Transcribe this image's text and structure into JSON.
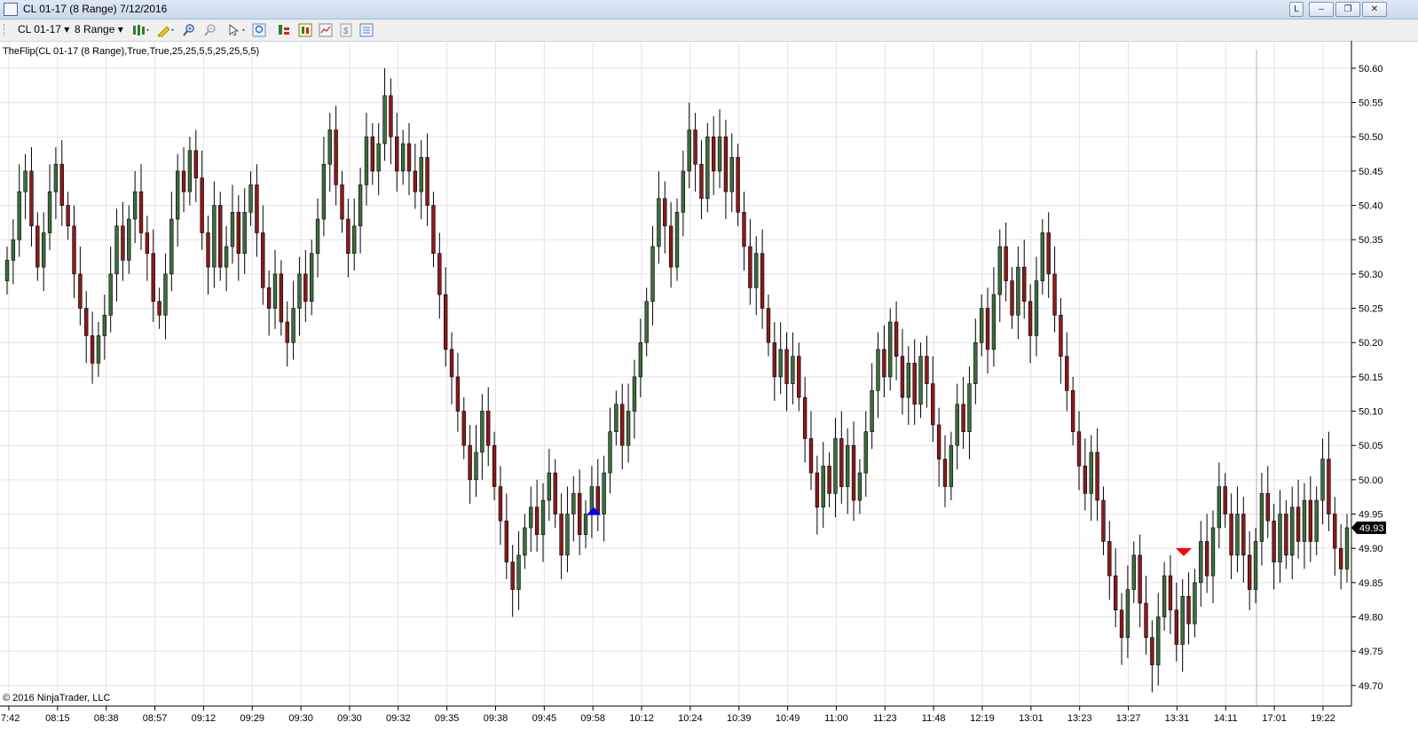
{
  "window": {
    "title": "CL 01-17 (8 Range)  7/12/2016",
    "buttons": [
      "L"
    ]
  },
  "toolbar": {
    "instrument": "CL 01-17",
    "period": "8 Range"
  },
  "indicator_label": "TheFlip(CL 01-17 (8 Range),True,True,25,25,5,5,25,25,5,5)",
  "copyright": "© 2016 NinjaTrader, LLC",
  "colors": {
    "up": "#3c6e3c",
    "down": "#8b1a1a",
    "buy_marker": "#0000ff",
    "sell_marker": "#ff0000"
  },
  "chart_data": {
    "type": "candlestick",
    "ylim": [
      49.67,
      50.64
    ],
    "yticks": [
      "50.60",
      "50.55",
      "50.50",
      "50.45",
      "50.40",
      "50.35",
      "50.30",
      "50.25",
      "50.20",
      "50.15",
      "50.10",
      "50.05",
      "50.00",
      "49.95",
      "49.90",
      "49.85",
      "49.80",
      "49.75",
      "49.70"
    ],
    "xticks": [
      "7:42",
      "08:15",
      "08:38",
      "08:57",
      "09:12",
      "09:29",
      "09:30",
      "09:30",
      "09:32",
      "09:35",
      "09:38",
      "09:45",
      "09:58",
      "10:12",
      "10:24",
      "10:39",
      "10:49",
      "11:00",
      "11:23",
      "11:48",
      "12:19",
      "13:01",
      "13:23",
      "13:27",
      "13:31",
      "14:11",
      "17:01",
      "19:22"
    ],
    "last_price": "49.93",
    "closes": [
      50.32,
      50.35,
      50.42,
      50.45,
      50.37,
      50.31,
      50.36,
      50.42,
      50.46,
      50.4,
      50.37,
      50.3,
      50.25,
      50.21,
      50.17,
      50.21,
      50.24,
      50.3,
      50.37,
      50.32,
      50.38,
      50.42,
      50.36,
      50.33,
      50.26,
      50.24,
      50.3,
      50.38,
      50.45,
      50.42,
      50.48,
      50.44,
      50.36,
      50.31,
      50.4,
      50.31,
      50.34,
      50.39,
      50.33,
      50.39,
      50.43,
      50.36,
      50.28,
      50.25,
      50.3,
      50.23,
      50.2,
      50.25,
      50.3,
      50.26,
      50.33,
      50.38,
      50.46,
      50.51,
      50.43,
      50.38,
      50.33,
      50.37,
      50.43,
      50.5,
      50.45,
      50.49,
      50.56,
      50.5,
      50.45,
      50.49,
      50.45,
      50.42,
      50.47,
      50.4,
      50.33,
      50.27,
      50.19,
      50.15,
      50.1,
      50.05,
      50.0,
      50.04,
      50.1,
      50.05,
      49.99,
      49.94,
      49.88,
      49.84,
      49.89,
      49.93,
      49.96,
      49.92,
      49.97,
      50.01,
      49.95,
      49.89,
      49.95,
      49.98,
      49.92,
      49.95,
      49.99,
      49.95,
      50.01,
      50.07,
      50.11,
      50.05,
      50.1,
      50.15,
      50.2,
      50.26,
      50.34,
      50.41,
      50.37,
      50.31,
      50.39,
      50.45,
      50.51,
      50.46,
      50.41,
      50.5,
      50.45,
      50.5,
      50.42,
      50.47,
      50.39,
      50.34,
      50.28,
      50.33,
      50.25,
      50.2,
      50.15,
      50.19,
      50.14,
      50.18,
      50.12,
      50.06,
      50.01,
      49.96,
      50.02,
      49.98,
      50.06,
      49.99,
      50.05,
      49.97,
      50.01,
      50.07,
      50.13,
      50.19,
      50.15,
      50.23,
      50.18,
      50.12,
      50.17,
      50.11,
      50.18,
      50.14,
      50.08,
      50.03,
      49.99,
      50.05,
      50.11,
      50.07,
      50.14,
      50.2,
      50.25,
      50.19,
      50.27,
      50.34,
      50.29,
      50.24,
      50.31,
      50.26,
      50.21,
      50.29,
      50.36,
      50.3,
      50.24,
      50.18,
      50.13,
      50.07,
      50.02,
      49.98,
      50.04,
      49.97,
      49.91,
      49.86,
      49.81,
      49.77,
      49.84,
      49.89,
      49.82,
      49.77,
      49.73,
      49.8,
      49.86,
      49.81,
      49.76,
      49.83,
      49.79,
      49.85,
      49.91,
      49.86,
      49.93,
      49.99,
      49.95,
      49.89,
      49.95,
      49.89,
      49.84,
      49.91,
      49.98,
      49.94,
      49.88,
      49.95,
      49.89,
      49.96,
      49.91,
      49.97,
      49.91,
      49.97,
      50.03,
      49.95,
      49.9,
      49.87,
      49.93
    ]
  }
}
